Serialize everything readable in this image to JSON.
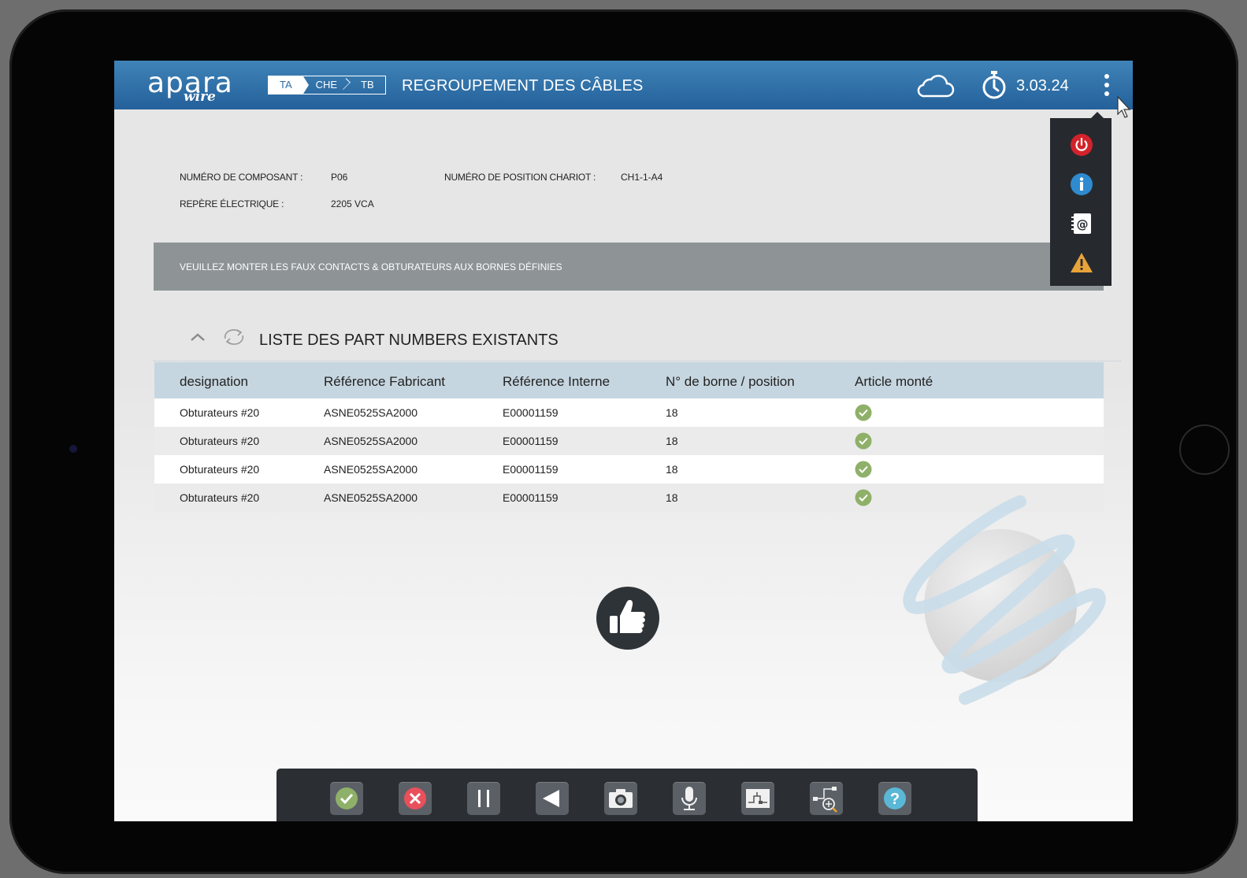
{
  "header": {
    "logo_main": "apara",
    "logo_sub": "wire",
    "breadcrumbs": [
      "TA",
      "CHE",
      "TB"
    ],
    "title": "REGROUPEMENT DES CÂBLES",
    "cloud_icon": "cloud-icon",
    "timer_icon": "stopwatch-icon",
    "timer_value": "3.03.24",
    "menu_icon": "kebab-menu-icon"
  },
  "info": {
    "component_label": "NUMÉRO DE COMPOSANT :",
    "component_value": "P06",
    "position_label": "NUMÉRO DE POSITION CHARIOT :",
    "position_value": "CH1-1-A4",
    "marker_label": "REPÈRE ÉLECTRIQUE :",
    "marker_value": "2205 VCA"
  },
  "banner": "VEUILLEZ MONTER LES FAUX CONTACTS & OBTURATEURS AUX BORNES DÉFINIES",
  "popup_menu": [
    {
      "icon": "power-icon",
      "color": "#d2232a"
    },
    {
      "icon": "info-icon",
      "color": "#2f8bd0"
    },
    {
      "icon": "contact-book-icon",
      "color": "#ffffff"
    },
    {
      "icon": "warning-icon",
      "color": "#e8a33a"
    }
  ],
  "list": {
    "title": "LISTE DES PART NUMBERS EXISTANTS",
    "columns": [
      "designation",
      "Référence Fabricant",
      "Référence Interne",
      "N° de borne / position",
      "Article monté"
    ],
    "rows": [
      {
        "designation": "Obturateurs #20",
        "ref_fab": "ASNE0525SA2000",
        "ref_int": "E00001159",
        "borne": "18",
        "mounted": true
      },
      {
        "designation": "Obturateurs #20",
        "ref_fab": "ASNE0525SA2000",
        "ref_int": "E00001159",
        "borne": "18",
        "mounted": true
      },
      {
        "designation": "Obturateurs #20",
        "ref_fab": "ASNE0525SA2000",
        "ref_int": "E00001159",
        "borne": "18",
        "mounted": true
      },
      {
        "designation": "Obturateurs #20",
        "ref_fab": "ASNE0525SA2000",
        "ref_int": "E00001159",
        "borne": "18",
        "mounted": true
      }
    ]
  },
  "toolbar": [
    "validate-icon",
    "cancel-icon",
    "pause-icon",
    "back-icon",
    "camera-icon",
    "microphone-icon",
    "schematic-icon",
    "zoom-diagram-icon",
    "help-icon"
  ],
  "colors": {
    "header": "#2e6ea5",
    "check": "#8fb069",
    "cancel": "#e8505b",
    "help": "#5bb7d6"
  }
}
